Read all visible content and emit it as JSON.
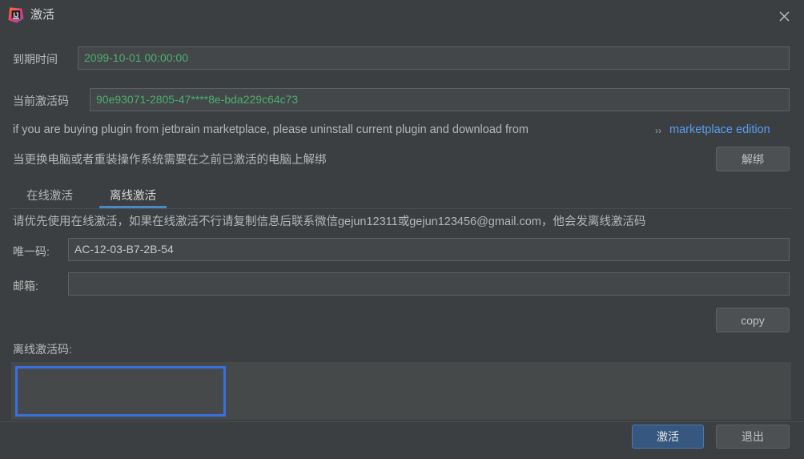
{
  "window": {
    "title": "激活",
    "app_icon": "intellij-idea-icon",
    "close_icon": "close-icon"
  },
  "fields": {
    "expire_label": "到期时间",
    "expire_value": "2099-10-01 00:00:00",
    "expire_value_color": "#4caf6d",
    "current_code_label": "当前激活码",
    "current_code_value": "90e93071-2805-47****8e-bda229c64c73",
    "current_code_color": "#4caf6d"
  },
  "notice": {
    "marketplace_text": "if you are buying plugin from jetbrain marketplace, please uninstall current plugin and download from",
    "chevrons": "››",
    "marketplace_link": "marketplace edition",
    "link_color": "#589df6",
    "unbind_text": "当更换电脑或者重装操作系统需要在之前已激活的电脑上解绑",
    "unbind_button": "解绑"
  },
  "tabs": [
    {
      "label": "在线激活",
      "active": false
    },
    {
      "label": "离线激活",
      "active": true
    }
  ],
  "offline": {
    "hint": "请优先使用在线激活，如果在线激活不行请复制信息后联系微信gejun12311或gejun123456@gmail.com，他会发离线激活码",
    "unique_code_label": "唯一码:",
    "unique_code_value": "AC-12-03-B7-2B-54",
    "email_label": "邮箱:",
    "email_value": "",
    "email_placeholder": "",
    "copy_button": "copy",
    "offline_code_label": "离线激活码:",
    "offline_code_value": "",
    "offline_code_placeholder": ""
  },
  "footer": {
    "activate_button": "激活",
    "activate_color": "#365880",
    "exit_button": "退出"
  }
}
